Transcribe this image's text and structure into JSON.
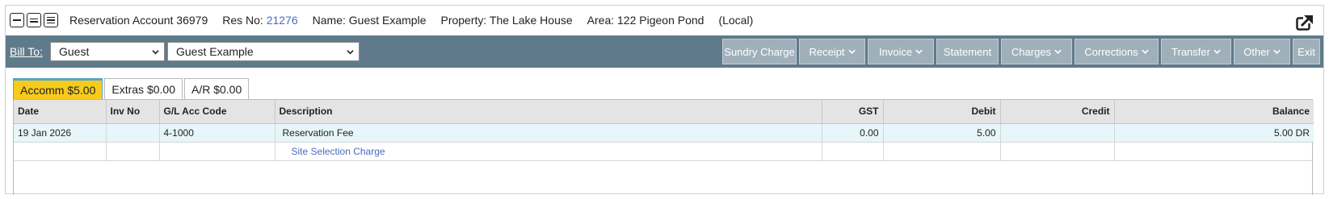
{
  "header": {
    "account": "Reservation Account 36979",
    "res_label": "Res No:",
    "res_no": "21276",
    "name": "Name: Guest Example",
    "property": "Property: The Lake House",
    "area": "Area: 122 Pigeon Pond",
    "scope": "(Local)",
    "view_icons": [
      "view-collapsed-icon",
      "view-medium-icon",
      "view-expanded-icon"
    ],
    "popout_icon": "external-link-icon"
  },
  "toolbar": {
    "bill_to_label": "Bill To:",
    "bill_to_type": "Guest",
    "bill_to_name": "Guest Example",
    "actions": [
      {
        "label": "Sundry Charge",
        "dropdown": false
      },
      {
        "label": "Receipt",
        "dropdown": true
      },
      {
        "label": "Invoice",
        "dropdown": true
      },
      {
        "label": "Statement",
        "dropdown": false
      },
      {
        "label": "Charges",
        "dropdown": true
      },
      {
        "label": "Corrections",
        "dropdown": true
      },
      {
        "label": "Transfer",
        "dropdown": true
      },
      {
        "label": "Other",
        "dropdown": true
      },
      {
        "label": "Exit",
        "dropdown": false
      }
    ]
  },
  "tabs": [
    {
      "label": "Accomm $5.00",
      "active": true
    },
    {
      "label": "Extras $0.00",
      "active": false
    },
    {
      "label": "A/R $0.00",
      "active": false
    }
  ],
  "table": {
    "columns": [
      "Date",
      "Inv No",
      "G/L Acc Code",
      "Description",
      "GST",
      "Debit",
      "Credit",
      "Balance"
    ],
    "rows": [
      {
        "date": "19 Jan 2026",
        "inv_no": "",
        "gl_code": "4-1000",
        "description": "Reservation Fee",
        "gst": "0.00",
        "debit": "5.00",
        "credit": "",
        "balance": "5.00 DR"
      },
      {
        "date": "",
        "inv_no": "",
        "gl_code": "",
        "description": "Site Selection Charge",
        "gst": "",
        "debit": "",
        "credit": "",
        "balance": ""
      }
    ]
  },
  "colors": {
    "toolbar_bg": "#5f7b8b",
    "button_bg": "#9fb0ba",
    "active_tab": "#f6cb1b",
    "highlight_row": "#e6f6fb",
    "link": "#4a6bbf"
  }
}
